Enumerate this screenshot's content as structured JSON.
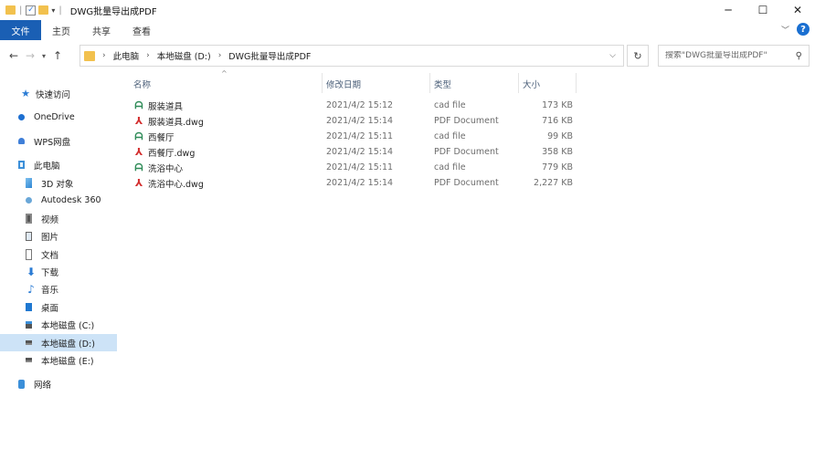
{
  "window": {
    "title": "DWG批量导出成PDF",
    "controls": {
      "minimize": "─",
      "maximize": "☐",
      "close": "✕"
    }
  },
  "ribbon": {
    "tabs": [
      "文件",
      "主页",
      "共享",
      "查看"
    ],
    "help": "?"
  },
  "address": {
    "crumbs": [
      "此电脑",
      "本地磁盘 (D:)",
      "DWG批量导出成PDF"
    ],
    "search_placeholder": "搜索\"DWG批量导出成PDF\""
  },
  "nav": {
    "items": [
      {
        "label": "快速访问",
        "icon": "star-icon"
      },
      {
        "label": "OneDrive",
        "icon": "cloud-icon"
      },
      {
        "label": "WPS网盘",
        "icon": "wps-cloud-icon"
      },
      {
        "label": "此电脑",
        "icon": "computer-icon"
      },
      {
        "label": "3D 对象",
        "icon": "cube-icon"
      },
      {
        "label": "Autodesk 360",
        "icon": "autodesk-icon"
      },
      {
        "label": "视频",
        "icon": "video-icon"
      },
      {
        "label": "图片",
        "icon": "picture-icon"
      },
      {
        "label": "文档",
        "icon": "document-icon"
      },
      {
        "label": "下载",
        "icon": "download-icon"
      },
      {
        "label": "音乐",
        "icon": "music-icon"
      },
      {
        "label": "桌面",
        "icon": "desktop-icon"
      },
      {
        "label": "本地磁盘 (C:)",
        "icon": "drive-c-icon"
      },
      {
        "label": "本地磁盘 (D:)",
        "icon": "drive-icon",
        "selected": true
      },
      {
        "label": "本地磁盘 (E:)",
        "icon": "drive-icon"
      },
      {
        "label": "网络",
        "icon": "network-icon"
      }
    ]
  },
  "columns": {
    "name": "名称",
    "date": "修改日期",
    "type": "类型",
    "size": "大小"
  },
  "files": [
    {
      "name": "服装道具",
      "date": "2021/4/2 15:12",
      "type": "cad file",
      "size": "173 KB",
      "icon": "cad-file-icon"
    },
    {
      "name": "服装道具.dwg",
      "date": "2021/4/2 15:14",
      "type": "PDF Document",
      "size": "716 KB",
      "icon": "pdf-file-icon"
    },
    {
      "name": "西餐厅",
      "date": "2021/4/2 15:11",
      "type": "cad file",
      "size": "99 KB",
      "icon": "cad-file-icon"
    },
    {
      "name": "西餐厅.dwg",
      "date": "2021/4/2 15:14",
      "type": "PDF Document",
      "size": "358 KB",
      "icon": "pdf-file-icon"
    },
    {
      "name": "洗浴中心",
      "date": "2021/4/2 15:11",
      "type": "cad file",
      "size": "779 KB",
      "icon": "cad-file-icon"
    },
    {
      "name": "洗浴中心.dwg",
      "date": "2021/4/2 15:14",
      "type": "PDF Document",
      "size": "2,227 KB",
      "icon": "pdf-file-icon"
    }
  ]
}
